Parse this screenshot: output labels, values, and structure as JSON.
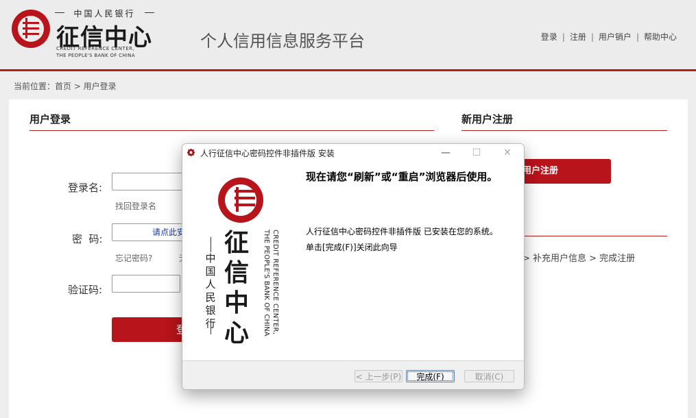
{
  "header": {
    "logo_top": "中国人民银行",
    "logo_main": "征信中心",
    "logo_en_line1": "CREDIT REFERENCE  CENTER,",
    "logo_en_line2": "THE PEOPLE'S BANK OF CHINA",
    "platform_title": "个人信用信息服务平台",
    "links": [
      "登录",
      "注册",
      "用户销户",
      "帮助中心"
    ],
    "link_separator": "|"
  },
  "breadcrumb": "当前位置：首页 > 用户登录",
  "login": {
    "title": "用户登录",
    "username_label": "登录名:",
    "find_username": "找回登录名",
    "password_label": "密  码:",
    "password_placeholder": "请点此安",
    "forgot_password": "忘记密码?",
    "forgot_partial": "无",
    "captcha_label": "验证码:",
    "login_button": "登"
  },
  "register": {
    "title": "新用户注册",
    "button": "用户注册",
    "steps": "> 补充用户信息 > 完成注册"
  },
  "dialog": {
    "title": "人行征信中心密码控件非插件版 安装",
    "heading": "现在请您“刷新”或“重启”浏览器后使用。",
    "line1": "人行征信中心密码控件非插件版 已安装在您的系统。",
    "line2": "单击[完成(F)]关闭此向导",
    "minimize": "—",
    "maximize": "☐",
    "close": "✕",
    "logo_big": "征信中心",
    "logo_small": "中国人民银行",
    "logo_en_line1": "CREDIT REFERENCE CENTER,",
    "logo_en_line2": "THE PEOPLE'S BANK OF CHINA",
    "back_button": "< 上一步(P)",
    "finish_button": "完成(F)",
    "cancel_button": "取消(C)"
  },
  "colors": {
    "brand_red": "#b8141b",
    "line_red": "#b71c1c"
  }
}
